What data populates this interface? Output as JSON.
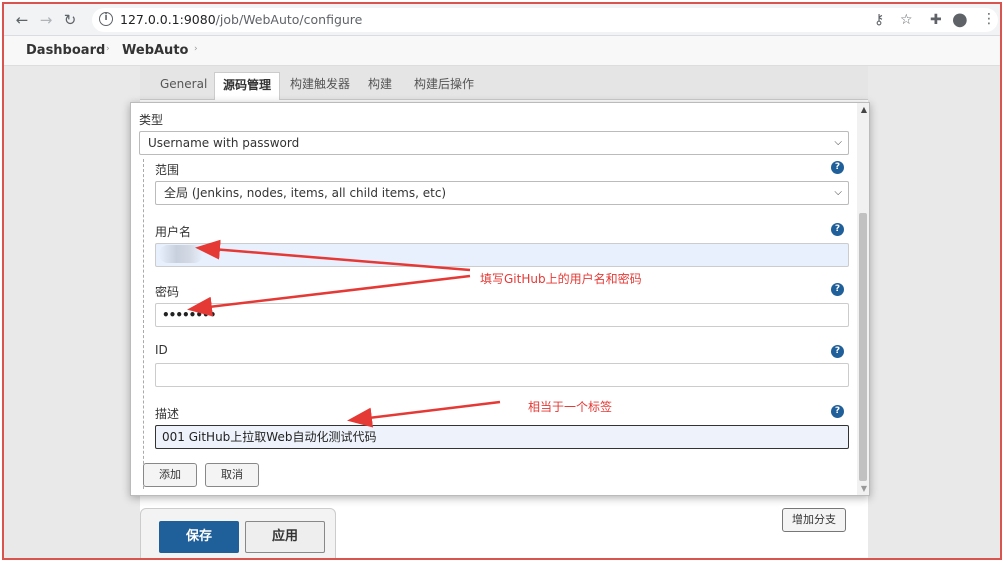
{
  "browser": {
    "url_host": "127.0.0.1:9080",
    "url_path": "/job/WebAuto/configure",
    "icons": [
      "back-icon",
      "forward-icon",
      "reload-icon",
      "info-icon",
      "key-icon",
      "star-icon",
      "extension-icon",
      "account-icon",
      "menu-icon"
    ]
  },
  "breadcrumb": {
    "items": [
      "Dashboard",
      "WebAuto"
    ]
  },
  "tabs": [
    {
      "label": "General",
      "active": false
    },
    {
      "label": "源码管理",
      "active": true
    },
    {
      "label": "构建触发器",
      "active": false
    },
    {
      "label": "构建",
      "active": false
    },
    {
      "label": "构建后操作",
      "active": false
    }
  ],
  "dialog": {
    "kind_label": "类型",
    "kind_value": "Username with password",
    "scope_label": "范围",
    "scope_value": "全局 (Jenkins, nodes, items, all child items, etc)",
    "username_label": "用户名",
    "username_value": "",
    "password_label": "密码",
    "password_value": "••••••••",
    "id_label": "ID",
    "id_value": "",
    "description_label": "描述",
    "description_value": "001 GitHub上拉取Web自动化测试代码",
    "add_button": "添加",
    "cancel_button": "取消"
  },
  "page_buttons": {
    "add_branch": "增加分支",
    "save": "保存",
    "apply": "应用"
  },
  "annotations": {
    "credentials_note": "填写GitHub上的用户名和密码",
    "description_note": "相当于一个标签",
    "color": "#e53935"
  },
  "colors": {
    "primary": "#1f5f9a",
    "frame_border": "#d9534f"
  }
}
